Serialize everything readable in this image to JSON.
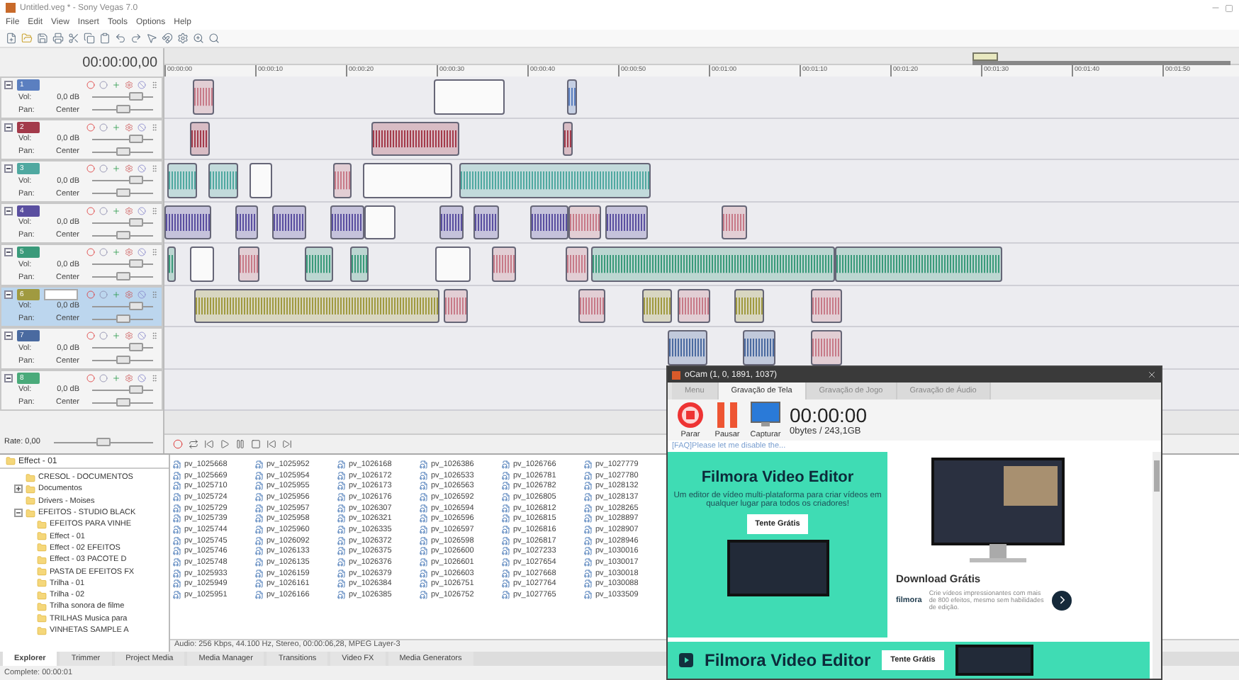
{
  "window": {
    "title": "Untitled.veg * - Sony Vegas 7.0"
  },
  "menu": [
    "File",
    "Edit",
    "View",
    "Insert",
    "Tools",
    "Options",
    "Help"
  ],
  "time_display": "00:00:00,00",
  "ruler": [
    "00:00:00",
    "00:00:10",
    "00:00:20",
    "00:00:30",
    "00:00:40",
    "00:00:50",
    "00:01:00",
    "00:01:10",
    "00:01:20",
    "00:01:30",
    "00:01:40",
    "00:01:50"
  ],
  "tracks": [
    {
      "number": "1",
      "color": "#5b7fc0",
      "selected": false,
      "volume": {
        "label": "Vol:",
        "value": "0,0 dB",
        "level": 0.72
      },
      "pan": {
        "label": "Pan:",
        "value": "Center",
        "level": 0.5
      }
    },
    {
      "number": "2",
      "color": "#a33a4a",
      "selected": false,
      "volume": {
        "label": "Vol:",
        "value": "0,0 dB",
        "level": 0.72
      },
      "pan": {
        "label": "Pan:",
        "value": "Center",
        "level": 0.5
      }
    },
    {
      "number": "3",
      "color": "#4fa8a0",
      "selected": false,
      "volume": {
        "label": "Vol:",
        "value": "0,0 dB",
        "level": 0.72
      },
      "pan": {
        "label": "Pan:",
        "value": "Center",
        "level": 0.5
      }
    },
    {
      "number": "4",
      "color": "#5a4fa0",
      "selected": false,
      "volume": {
        "label": "Vol:",
        "value": "0,0 dB",
        "level": 0.72
      },
      "pan": {
        "label": "Pan:",
        "value": "Center",
        "level": 0.5
      }
    },
    {
      "number": "5",
      "color": "#3a9a7a",
      "selected": false,
      "volume": {
        "label": "Vol:",
        "value": "0,0 dB",
        "level": 0.72
      },
      "pan": {
        "label": "Pan:",
        "value": "Center",
        "level": 0.5
      }
    },
    {
      "number": "6",
      "color": "#a09a40",
      "selected": true,
      "volume": {
        "label": "Vol:",
        "value": "0,0 dB",
        "level": 0.72
      },
      "pan": {
        "label": "Pan:",
        "value": "Center",
        "level": 0.5
      }
    },
    {
      "number": "7",
      "color": "#4a6aa0",
      "selected": false,
      "volume": {
        "label": "Vol:",
        "value": "0,0 dB",
        "level": 0.72
      },
      "pan": {
        "label": "Pan:",
        "value": "Center",
        "level": 0.5
      }
    },
    {
      "number": "8",
      "color": "#4aaa7a",
      "selected": false,
      "volume": {
        "label": "Vol:",
        "value": "0,0 dB",
        "level": 0.72
      },
      "pan": {
        "label": "Pan:",
        "value": "Center",
        "level": 0.5
      }
    }
  ],
  "rate": {
    "label": "Rate: 0,00",
    "level": 0.5
  },
  "explorer": {
    "path": "Effect - 01",
    "tree": [
      {
        "label": "CRESOL - DOCUMENTOS"
      },
      {
        "label": "Documentos",
        "expanded": false
      },
      {
        "label": "Drivers - Moises"
      },
      {
        "label": "EFEITOS - STUDIO BLACK",
        "expanded": true,
        "children": [
          {
            "label": "EFEITOS PARA VINHE"
          },
          {
            "label": "Effect - 01"
          },
          {
            "label": "Effect - 02 EFEITOS"
          },
          {
            "label": "Effect - 03 PACOTE D"
          },
          {
            "label": "PASTA DE EFEITOS FX"
          },
          {
            "label": "Trilha - 01"
          },
          {
            "label": "Trilha - 02"
          },
          {
            "label": "Trilha sonora de filme"
          },
          {
            "label": "TRILHAS Musica para"
          },
          {
            "label": "VINHETAS SAMPLE A"
          }
        ]
      }
    ],
    "files": [
      "pv_1025668",
      "pv_1025669",
      "pv_1025710",
      "pv_1025724",
      "pv_1025729",
      "pv_1025739",
      "pv_1025744",
      "pv_1025745",
      "pv_1025746",
      "pv_1025748",
      "pv_1025933",
      "pv_1025949",
      "pv_1025951",
      "pv_1025952",
      "pv_1025954",
      "pv_1025955",
      "pv_1025956",
      "pv_1025957",
      "pv_1025958",
      "pv_1025960",
      "pv_1026092",
      "pv_1026133",
      "pv_1026135",
      "pv_1026159",
      "pv_1026161",
      "pv_1026166",
      "pv_1026168",
      "pv_1026172",
      "pv_1026173",
      "pv_1026176",
      "pv_1026307",
      "pv_1026321",
      "pv_1026335",
      "pv_1026372",
      "pv_1026375",
      "pv_1026376",
      "pv_1026379",
      "pv_1026384",
      "pv_1026385",
      "pv_1026386",
      "pv_1026533",
      "pv_1026563",
      "pv_1026592",
      "pv_1026594",
      "pv_1026596",
      "pv_1026597",
      "pv_1026598",
      "pv_1026600",
      "pv_1026601",
      "pv_1026603",
      "pv_1026751",
      "pv_1026752",
      "pv_1026766",
      "pv_1026781",
      "pv_1026782",
      "pv_1026805",
      "pv_1026812",
      "pv_1026815",
      "pv_1026816",
      "pv_1026817",
      "pv_1027233",
      "pv_1027654",
      "pv_1027668",
      "pv_1027764",
      "pv_1027765",
      "pv_1027779",
      "pv_1027780",
      "pv_1028132",
      "pv_1028137",
      "pv_1028265",
      "pv_1028897",
      "pv_1028907",
      "pv_1028946",
      "pv_1030016",
      "pv_1030017",
      "pv_1030018",
      "pv_1030088",
      "pv_1033509"
    ],
    "info": "Audio: 256 Kbps, 44.100 Hz, Stereo, 00:00:06,28, MPEG Layer-3"
  },
  "tabs": [
    {
      "label": "Explorer",
      "selected": true
    },
    {
      "label": "Trimmer",
      "selected": false
    },
    {
      "label": "Project Media",
      "selected": false
    },
    {
      "label": "Media Manager",
      "selected": false
    },
    {
      "label": "Transitions",
      "selected": false
    },
    {
      "label": "Video FX",
      "selected": false
    },
    {
      "label": "Media Generators",
      "selected": false
    }
  ],
  "status_bar": "Complete: 00:00:01",
  "ocam": {
    "title": "oCam (1, 0, 1891, 1037)",
    "tabs": [
      {
        "label": "Menu",
        "selected": false
      },
      {
        "label": "Gravação de Tela",
        "selected": true
      },
      {
        "label": "Gravação de Jogo",
        "selected": false
      },
      {
        "label": "Gravação de Áudio",
        "selected": false
      }
    ],
    "buttons": [
      {
        "kind": "stop",
        "label": "Parar"
      },
      {
        "kind": "pause",
        "label": "Pausar"
      },
      {
        "kind": "capture",
        "label": "Capturar"
      }
    ],
    "time": "00:00:00",
    "size": "0bytes / 243,1GB",
    "faq": "[FAQ]Please let me disable the...",
    "ad": {
      "heading": "Filmora Video Editor",
      "text": "Um editor de vídeo multi-plataforma para criar vídeos em qualquer lugar para todos os criadores!",
      "cta": "Tente Grátis",
      "download": "Download Grátis",
      "download_text": "Crie vídeos impressionantes com mais de 800 efeitos, mesmo sem habilidades de edição.",
      "brand": "filmora"
    },
    "banner": {
      "heading": "Filmora Video Editor",
      "cta": "Tente Grátis"
    }
  }
}
